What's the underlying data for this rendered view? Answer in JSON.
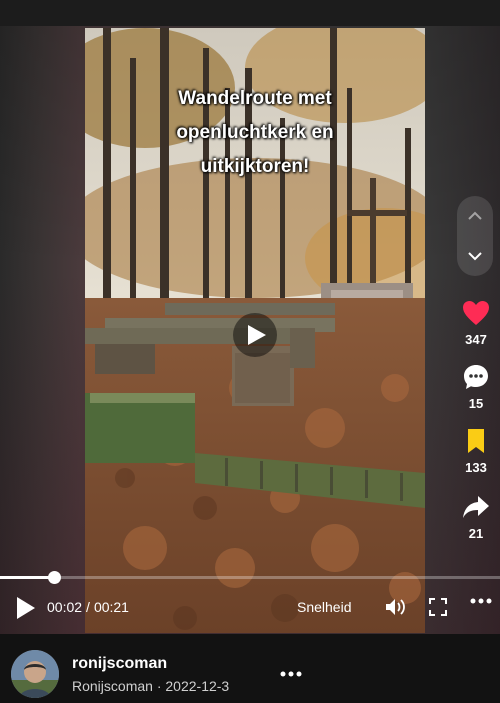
{
  "video": {
    "overlay_lines": [
      "Wandelroute met",
      "openluchtkerk en",
      "uitkijktoren!"
    ]
  },
  "actions": {
    "likes": "347",
    "comments": "15",
    "saves": "133",
    "shares": "21"
  },
  "player": {
    "current_time": "00:02",
    "separator": "/",
    "duration": "00:21",
    "progress_fraction": 0.108,
    "speed_label": "Snelheid"
  },
  "author": {
    "username": "ronijscoman",
    "display_name": "Ronijscoman",
    "dot": "·",
    "date": "2022-12-3"
  },
  "colors": {
    "like": "#fe2c55",
    "save": "#facc15"
  },
  "icons": {
    "like": "heart-icon",
    "comment": "comment-icon",
    "save": "bookmark-icon",
    "share": "share-icon",
    "play": "play-icon",
    "volume": "volume-icon",
    "fullscreen": "fullscreen-icon",
    "more": "more-icon",
    "nav_up": "chevron-up-icon",
    "nav_down": "chevron-down-icon"
  }
}
